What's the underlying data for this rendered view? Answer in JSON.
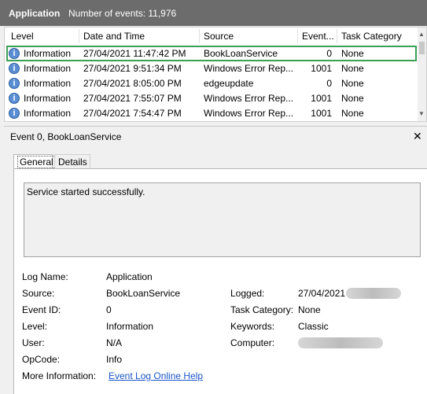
{
  "header": {
    "title": "Application",
    "event_count": "Number of events: 11,976"
  },
  "columns": [
    "Level",
    "Date and Time",
    "Source",
    "Event...",
    "Task Category"
  ],
  "events": [
    {
      "level": "Information",
      "datetime": "27/04/2021 11:47:42 PM",
      "source": "BookLoanService",
      "event_id": "0",
      "category": "None"
    },
    {
      "level": "Information",
      "datetime": "27/04/2021 9:51:34 PM",
      "source": "Windows Error Rep...",
      "event_id": "1001",
      "category": "None"
    },
    {
      "level": "Information",
      "datetime": "27/04/2021 8:05:00 PM",
      "source": "edgeupdate",
      "event_id": "0",
      "category": "None"
    },
    {
      "level": "Information",
      "datetime": "27/04/2021 7:55:07 PM",
      "source": "Windows Error Rep...",
      "event_id": "1001",
      "category": "None"
    },
    {
      "level": "Information",
      "datetime": "27/04/2021 7:54:47 PM",
      "source": "Windows Error Rep...",
      "event_id": "1001",
      "category": "None"
    }
  ],
  "icons": {
    "info": "information-icon",
    "close": "close-icon"
  },
  "colors": {
    "header_bg": "#6c6c6c",
    "selection_outline": "#3aa055",
    "link": "#1a55c9"
  },
  "detail": {
    "title": "Event 0, BookLoanService",
    "tabs": [
      "General",
      "Details"
    ],
    "message": "Service started successfully.",
    "fields": {
      "log_name_label": "Log Name:",
      "log_name": "Application",
      "source_label": "Source:",
      "source": "BookLoanService",
      "event_id_label": "Event ID:",
      "event_id": "0",
      "level_label": "Level:",
      "level": "Information",
      "user_label": "User:",
      "user": "N/A",
      "opcode_label": "OpCode:",
      "opcode": "Info",
      "more_info_label": "More Information:",
      "more_info_link": "Event Log Online Help",
      "logged_label": "Logged:",
      "logged": "27/04/2021",
      "task_category_label": "Task Category:",
      "task_category": "None",
      "keywords_label": "Keywords:",
      "keywords": "Classic",
      "computer_label": "Computer:"
    }
  }
}
